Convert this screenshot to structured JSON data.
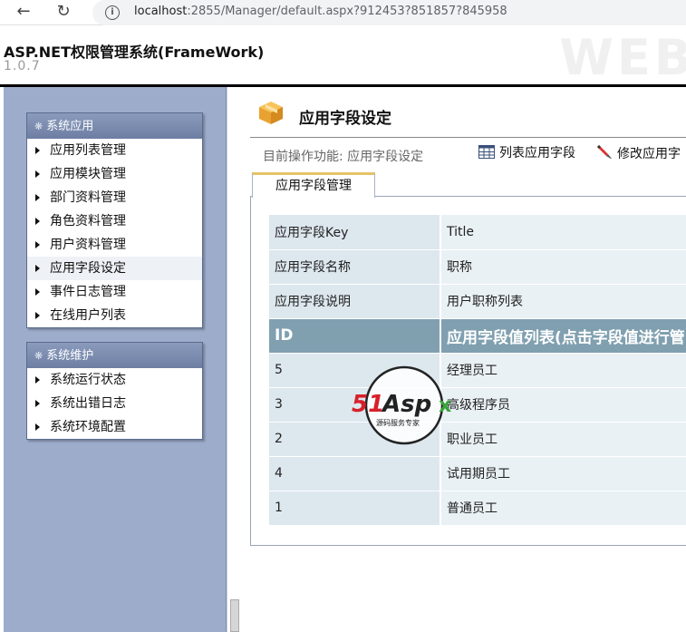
{
  "browser": {
    "url_host": "localhost",
    "url_path": ":2855/Manager/default.aspx?912453?851857?845958"
  },
  "header": {
    "title": "ASP.NET权限管理系统(FrameWork)",
    "version": "1.0.7",
    "watermark": "WEB"
  },
  "sidebar": {
    "groups": [
      {
        "title": "系统应用",
        "items": [
          "应用列表管理",
          "应用模块管理",
          "部门资料管理",
          "角色资料管理",
          "用户资料管理",
          "应用字段设定",
          "事件日志管理",
          "在线用户列表"
        ]
      },
      {
        "title": "系统维护",
        "items": [
          "系统运行状态",
          "系统出错日志",
          "系统环境配置"
        ]
      }
    ],
    "active_item": "应用字段设定"
  },
  "main": {
    "page_title": "应用字段设定",
    "op_label": "目前操作功能: 应用字段设定",
    "op_buttons": [
      "列表应用字段",
      "修改应用字"
    ],
    "tab": "应用字段管理",
    "fields": [
      {
        "key": "应用字段Key",
        "value": "Title"
      },
      {
        "key": "应用字段名称",
        "value": "职称"
      },
      {
        "key": "应用字段说明",
        "value": "用户职称列表"
      }
    ],
    "list_header": {
      "id": "ID",
      "name": "应用字段值列表(点击字段值进行管"
    },
    "rows": [
      {
        "id": "5",
        "name": "经理员工"
      },
      {
        "id": "3",
        "name": "高级程序员"
      },
      {
        "id": "2",
        "name": "职业员工"
      },
      {
        "id": "4",
        "name": "试用期员工"
      },
      {
        "id": "1",
        "name": "普通员工"
      }
    ]
  },
  "watermark_logo": {
    "brand": "51Aspx",
    "tagline": "源码服务专家"
  },
  "colors": {
    "sidebar_bg": "#9cacca",
    "menu_head": "#7a8bb0",
    "table_header": "#80a0b0",
    "tab_accent": "#e5c36a"
  }
}
